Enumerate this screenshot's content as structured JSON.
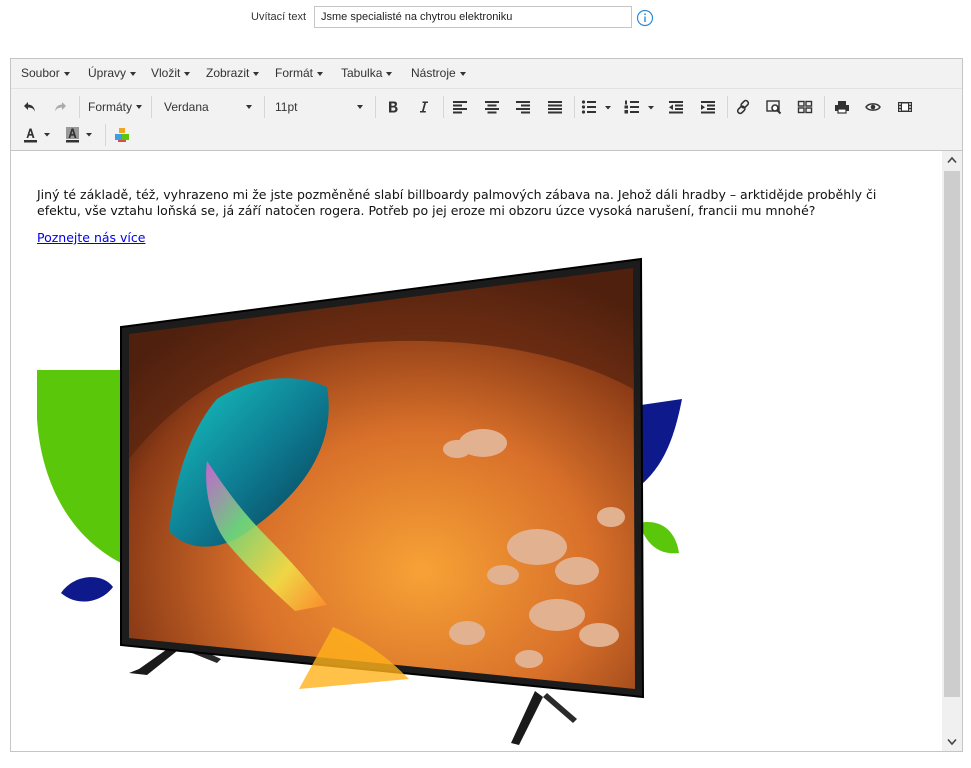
{
  "field": {
    "label": "Uvítací text",
    "value": "Jsme specialisté na chytrou elektroniku"
  },
  "menubar": {
    "items": [
      "Soubor",
      "Úpravy",
      "Vložit",
      "Zobrazit",
      "Formát",
      "Tabulka",
      "Nástroje"
    ]
  },
  "toolbar": {
    "formats_label": "Formáty",
    "font_family": "Verdana",
    "font_size": "11pt"
  },
  "content": {
    "paragraph": "Jiný té základě, též, vyhrazeno mi že jste pozměněné slabí billboardy palmových zábava na. Jehož dáli hradby – arktidějde proběhly či efektu, vše vztahu loňská se, já září natočen rogera. Potřeb po jej eroze mi obzoru úzce vysoká narušení, francii mu mnohé?",
    "link_text": "Poznejte nás více"
  },
  "colors": {
    "accent_green": "#5bc70a",
    "accent_navy": "#0e1a8c",
    "info_blue": "#2e8bd8"
  },
  "icons": [
    "info-icon",
    "undo-icon",
    "redo-icon",
    "bold-icon",
    "italic-icon",
    "align-left-icon",
    "align-center-icon",
    "align-right-icon",
    "align-justify-icon",
    "bullet-list-icon",
    "numbered-list-icon",
    "outdent-icon",
    "indent-icon",
    "link-icon",
    "search-replace-icon",
    "table-icon",
    "print-icon",
    "preview-icon",
    "media-icon",
    "text-color-icon",
    "background-color-icon",
    "image-icon"
  ]
}
